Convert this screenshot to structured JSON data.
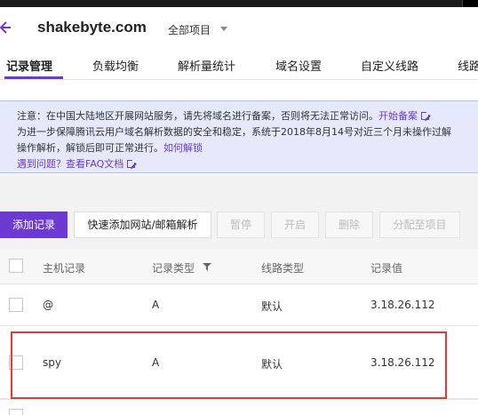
{
  "header": {
    "domain": "shakebyte.com",
    "project_selector": "全部项目"
  },
  "tabs": [
    {
      "label": "记录管理",
      "active": true
    },
    {
      "label": "负载均衡"
    },
    {
      "label": "解析量统计"
    },
    {
      "label": "域名设置"
    },
    {
      "label": "自定义线路"
    },
    {
      "label": "线路"
    }
  ],
  "notice": {
    "line1": "注意：在中国大陆地区开展网站服务，请先将域名进行备案，否则将无法正常访问。",
    "line1_link": "开始备案",
    "line2": "为进一步保障腾讯云用户域名解析数据的安全和稳定，系统于2018年8月14号对近三个月未操作过解",
    "line3": "操作解析，解锁后即可正常进行。",
    "line3_link": "如何解锁",
    "line4": "遇到问题？查看FAQ文档"
  },
  "toolbar": {
    "add_record": "添加记录",
    "quick_add": "快速添加网站/邮箱解析",
    "pause": "暂停",
    "enable": "开启",
    "delete": "删除",
    "assign_project": "分配至项目"
  },
  "table": {
    "columns": [
      "主机记录",
      "记录类型",
      "线路类型",
      "记录值"
    ],
    "rows": [
      {
        "host": "@",
        "type": "A",
        "line": "默认",
        "value": "3.18.26.112"
      },
      {
        "host": "spy",
        "type": "A",
        "line": "默认",
        "value": "3.18.26.112"
      }
    ]
  },
  "colors": {
    "accent": "#6c3ad3",
    "highlight_box": "#e53935",
    "notice_bg": "#e5e9fb"
  }
}
